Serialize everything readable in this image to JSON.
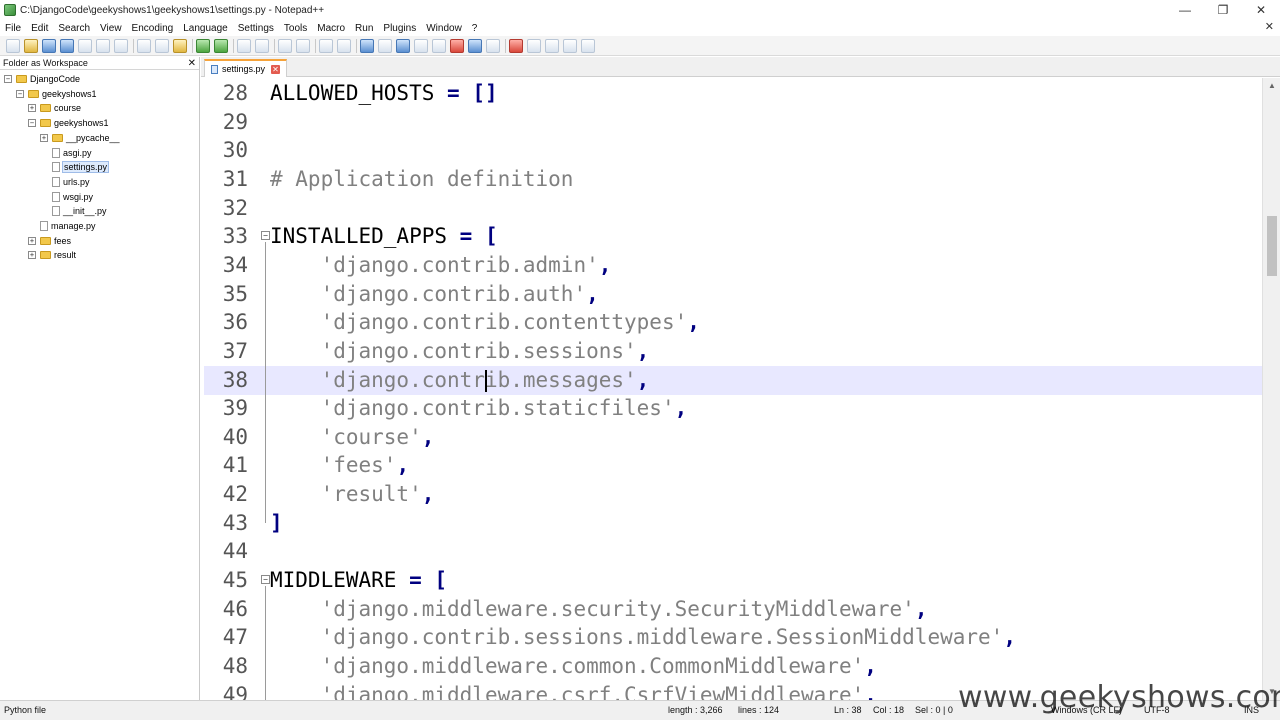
{
  "window": {
    "title": "C:\\DjangoCode\\geekyshows1\\geekyshows1\\settings.py - Notepad++",
    "controls": [
      "—",
      "❐",
      "✕"
    ]
  },
  "menu": {
    "items": [
      "File",
      "Edit",
      "Search",
      "View",
      "Encoding",
      "Language",
      "Settings",
      "Tools",
      "Macro",
      "Run",
      "Plugins",
      "Window",
      "?"
    ],
    "close_glyph": "✕"
  },
  "panel": {
    "title": "Folder as Workspace",
    "close_glyph": "✕",
    "tree": [
      {
        "label": "DjangoCode",
        "expander": "⊟",
        "kind": "folder"
      },
      {
        "label": "geekyshows1",
        "expander": "⊟",
        "kind": "folder"
      },
      {
        "label": "course",
        "expander": "⊞",
        "kind": "folder"
      },
      {
        "label": "geekyshows1",
        "expander": "⊟",
        "kind": "folder"
      },
      {
        "label": "__pycache__",
        "expander": "⊞",
        "kind": "folder"
      },
      {
        "label": "asgi.py",
        "expander": "",
        "kind": "file"
      },
      {
        "label": "settings.py",
        "expander": "",
        "kind": "file"
      },
      {
        "label": "urls.py",
        "expander": "",
        "kind": "file"
      },
      {
        "label": "wsgi.py",
        "expander": "",
        "kind": "file"
      },
      {
        "label": "__init__.py",
        "expander": "",
        "kind": "file"
      },
      {
        "label": "manage.py",
        "expander": "",
        "kind": "file"
      },
      {
        "label": "fees",
        "expander": "⊞",
        "kind": "folder"
      },
      {
        "label": "result",
        "expander": "⊞",
        "kind": "folder"
      }
    ]
  },
  "tab": {
    "label": "settings.py",
    "close_glyph": "✕"
  },
  "editor": {
    "lines": [
      {
        "n": "28",
        "fold": "",
        "tokens": [
          [
            "ident",
            "ALLOWED_HOSTS"
          ],
          [
            "default",
            " "
          ],
          [
            "op",
            "="
          ],
          [
            "default",
            " "
          ],
          [
            "op",
            "[]"
          ]
        ]
      },
      {
        "n": "29",
        "fold": "",
        "tokens": []
      },
      {
        "n": "30",
        "fold": "",
        "tokens": []
      },
      {
        "n": "31",
        "fold": "",
        "tokens": [
          [
            "comment",
            "# Application definition"
          ]
        ]
      },
      {
        "n": "32",
        "fold": "",
        "tokens": []
      },
      {
        "n": "33",
        "fold": "⊟",
        "tokens": [
          [
            "ident",
            "INSTALLED_APPS"
          ],
          [
            "default",
            " "
          ],
          [
            "op",
            "="
          ],
          [
            "default",
            " "
          ],
          [
            "op",
            "["
          ]
        ]
      },
      {
        "n": "34",
        "fold": "",
        "tokens": [
          [
            "default",
            "    "
          ],
          [
            "string",
            "'django.contrib.admin'"
          ],
          [
            "op",
            ","
          ]
        ]
      },
      {
        "n": "35",
        "fold": "",
        "tokens": [
          [
            "default",
            "    "
          ],
          [
            "string",
            "'django.contrib.auth'"
          ],
          [
            "op",
            ","
          ]
        ]
      },
      {
        "n": "36",
        "fold": "",
        "tokens": [
          [
            "default",
            "    "
          ],
          [
            "string",
            "'django.contrib.contenttypes'"
          ],
          [
            "op",
            ","
          ]
        ]
      },
      {
        "n": "37",
        "fold": "",
        "tokens": [
          [
            "default",
            "    "
          ],
          [
            "string",
            "'django.contrib.sessions'"
          ],
          [
            "op",
            ","
          ]
        ]
      },
      {
        "n": "38",
        "fold": "",
        "tokens": [
          [
            "default",
            "    "
          ],
          [
            "string",
            "'django.contrib.messages'"
          ],
          [
            "op",
            ","
          ]
        ]
      },
      {
        "n": "39",
        "fold": "",
        "tokens": [
          [
            "default",
            "    "
          ],
          [
            "string",
            "'django.contrib.staticfiles'"
          ],
          [
            "op",
            ","
          ]
        ]
      },
      {
        "n": "40",
        "fold": "",
        "tokens": [
          [
            "default",
            "    "
          ],
          [
            "string",
            "'course'"
          ],
          [
            "op",
            ","
          ]
        ]
      },
      {
        "n": "41",
        "fold": "",
        "tokens": [
          [
            "default",
            "    "
          ],
          [
            "string",
            "'fees'"
          ],
          [
            "op",
            ","
          ]
        ]
      },
      {
        "n": "42",
        "fold": "",
        "tokens": [
          [
            "default",
            "    "
          ],
          [
            "string",
            "'result'"
          ],
          [
            "op",
            ","
          ]
        ]
      },
      {
        "n": "43",
        "fold": "",
        "tokens": [
          [
            "op",
            "]"
          ]
        ]
      },
      {
        "n": "44",
        "fold": "",
        "tokens": []
      },
      {
        "n": "45",
        "fold": "⊟",
        "tokens": [
          [
            "ident",
            "MIDDLEWARE"
          ],
          [
            "default",
            " "
          ],
          [
            "op",
            "="
          ],
          [
            "default",
            " "
          ],
          [
            "op",
            "["
          ]
        ]
      },
      {
        "n": "46",
        "fold": "",
        "tokens": [
          [
            "default",
            "    "
          ],
          [
            "string",
            "'django.middleware.security.SecurityMiddleware'"
          ],
          [
            "op",
            ","
          ]
        ]
      },
      {
        "n": "47",
        "fold": "",
        "tokens": [
          [
            "default",
            "    "
          ],
          [
            "string",
            "'django.contrib.sessions.middleware.SessionMiddleware'"
          ],
          [
            "op",
            ","
          ]
        ]
      },
      {
        "n": "48",
        "fold": "",
        "tokens": [
          [
            "default",
            "    "
          ],
          [
            "string",
            "'django.middleware.common.CommonMiddleware'"
          ],
          [
            "op",
            ","
          ]
        ]
      },
      {
        "n": "49",
        "fold": "",
        "tokens": [
          [
            "default",
            "    "
          ],
          [
            "string",
            "'django.middleware.csrf.CsrfViewMiddleware'"
          ],
          [
            "op",
            ","
          ]
        ]
      }
    ],
    "current_line": "38",
    "colors": {
      "operator": "#000080",
      "string": "#808080",
      "comment": "#808080",
      "current_line_bg": "#e8e8ff"
    }
  },
  "status": {
    "file_type": "Python file",
    "length": "length : 3,266",
    "lines": "lines : 124",
    "ln": "Ln : 38",
    "col": "Col : 18",
    "sel": "Sel : 0 | 0",
    "eol": "Windows (CR LF)",
    "encoding": "UTF-8",
    "mode": "INS"
  },
  "watermark": "www.geekyshows.com"
}
